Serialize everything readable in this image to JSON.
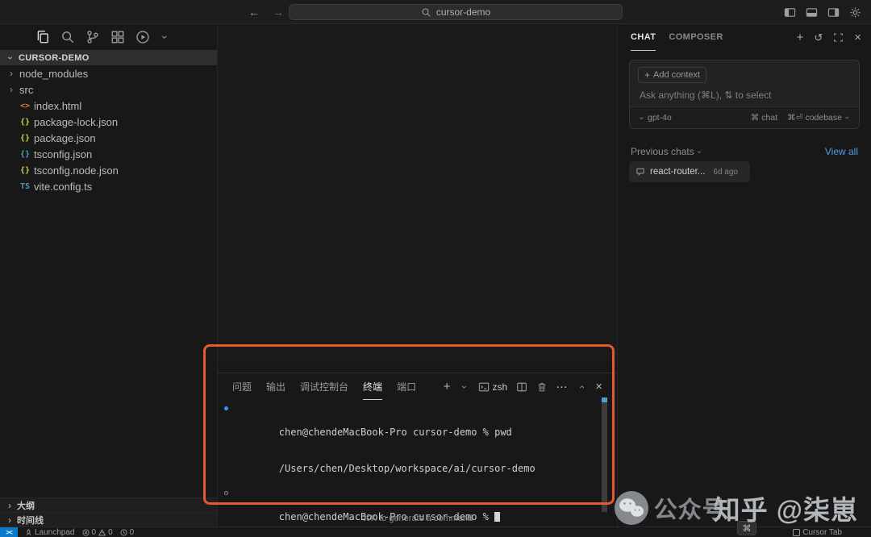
{
  "titlebar": {
    "search_value": "cursor-demo"
  },
  "explorer": {
    "root_label": "CURSOR-DEMO",
    "files": [
      {
        "name": "node_modules",
        "kind": "folder"
      },
      {
        "name": "src",
        "kind": "folder"
      },
      {
        "name": "index.html",
        "glyph": "<>"
      },
      {
        "name": "package-lock.json",
        "glyph": "{}"
      },
      {
        "name": "package.json",
        "glyph": "{}"
      },
      {
        "name": "tsconfig.json",
        "glyph": "{}"
      },
      {
        "name": "tsconfig.node.json",
        "glyph": "{}"
      },
      {
        "name": "vite.config.ts",
        "glyph": "TS"
      }
    ],
    "sections": [
      {
        "label": "大纲"
      },
      {
        "label": "时间线"
      }
    ]
  },
  "panel": {
    "tabs": [
      {
        "label": "问题"
      },
      {
        "label": "输出"
      },
      {
        "label": "调试控制台"
      },
      {
        "label": "终端"
      },
      {
        "label": "端口"
      }
    ],
    "shell_label": "zsh",
    "terminal": {
      "lines": [
        {
          "text": "chen@chendeMacBook-Pro cursor-demo % pwd",
          "bullet": "blue"
        },
        {
          "text": "/Users/chen/Desktop/workspace/ai/cursor-demo",
          "bullet": "none"
        },
        {
          "text": "chen@chendeMacBook-Pro cursor-demo % ",
          "bullet": "gray",
          "cursor": true
        }
      ]
    },
    "hint": "⌘K to generate a command"
  },
  "chat": {
    "tabs": [
      {
        "label": "CHAT"
      },
      {
        "label": "COMPOSER"
      }
    ],
    "add_context_label": "Add context",
    "placeholder": "Ask anything (⌘L), ⇅ to select",
    "model_label": "gpt-4o",
    "submit_hints": [
      {
        "keys": "⌘",
        "label": "chat"
      },
      {
        "keys": "⌘⏎",
        "label": "codebase"
      }
    ],
    "previous_label": "Previous chats",
    "view_all_label": "View all",
    "history_item": {
      "title": "react-router...",
      "time": "6d ago"
    }
  },
  "statusbar": {
    "remote_glyph": "><",
    "launchpad_label": "Launchpad",
    "problems": {
      "errors": "0",
      "warnings": "0"
    },
    "extra_count": "0",
    "cursor_tab_label": "Cursor Tab",
    "cmd_key": "⌘"
  },
  "watermark": {
    "wechat_label": "公众号",
    "zhihu_label": "知乎 @柒崽"
  },
  "colors": {
    "highlight_orange": "#e25a2e",
    "link_blue": "#4f9fe8",
    "remote_blue": "#0a7acc",
    "file_icon_orange": "#e37933",
    "file_icon_yellow": "#cbcb41",
    "file_icon_blue": "#519aba",
    "terminal_bullet_blue": "#3794ff"
  }
}
